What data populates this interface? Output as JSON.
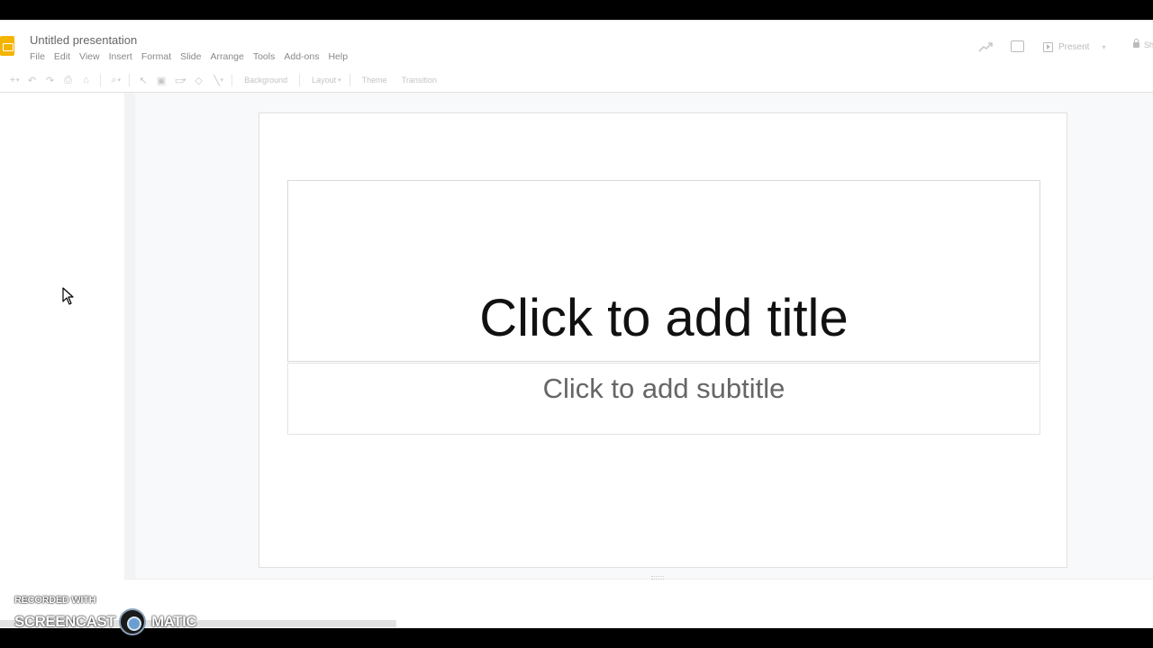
{
  "app": {
    "doc_title": "Untitled presentation",
    "menu": [
      "File",
      "Edit",
      "View",
      "Insert",
      "Format",
      "Slide",
      "Arrange",
      "Tools",
      "Add-ons",
      "Help"
    ],
    "present_label": "Present",
    "share_label": "Sh"
  },
  "toolbar": {
    "background_label": "Background",
    "layout_label": "Layout",
    "theme_label": "Theme",
    "transition_label": "Transition"
  },
  "slide": {
    "title_placeholder": "Click to add title",
    "subtitle_placeholder": "Click to add subtitle"
  },
  "watermark": {
    "recorded_with": "RECORDED WITH",
    "brand_left": "SCREENCAST",
    "brand_right": "MATIC"
  },
  "colors": {
    "logo": "#f4b400",
    "canvas_bg": "#f8f9fa"
  }
}
